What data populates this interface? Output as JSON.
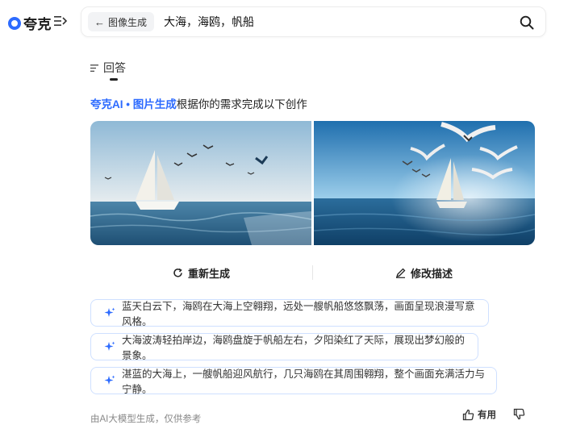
{
  "header": {
    "logo_text": "夸克",
    "back_chip_label": "图像生成",
    "query": "大海，海鸥，帆船"
  },
  "tab": {
    "label": "回答"
  },
  "intro": {
    "brand": "夸克AI",
    "separator": " • ",
    "feature": "图片生成",
    "rest": "根据你的需求完成以下创作"
  },
  "images": [
    {
      "alt": "sailboat-with-seagulls-1"
    },
    {
      "alt": "sailboat-with-seagulls-2"
    }
  ],
  "actions": {
    "regenerate_label": "重新生成",
    "edit_label": "修改描述"
  },
  "suggestions": [
    "蓝天白云下，海鸥在大海上空翱翔，远处一艘帆船悠悠飘荡，画面呈现浪漫写意风格。",
    "大海波涛轻拍岸边，海鸥盘旋于帆船左右，夕阳染红了天际，展现出梦幻般的景象。",
    "湛蓝的大海上，一艘帆船迎风航行，几只海鸥在其周围翱翔，整个画面充满活力与宁静。"
  ],
  "footer": {
    "note": "由AI大模型生成，仅供参考",
    "like_label": "有用"
  },
  "colors": {
    "accent": "#2d6bff",
    "suggestion_border": "#cfe0ff"
  }
}
